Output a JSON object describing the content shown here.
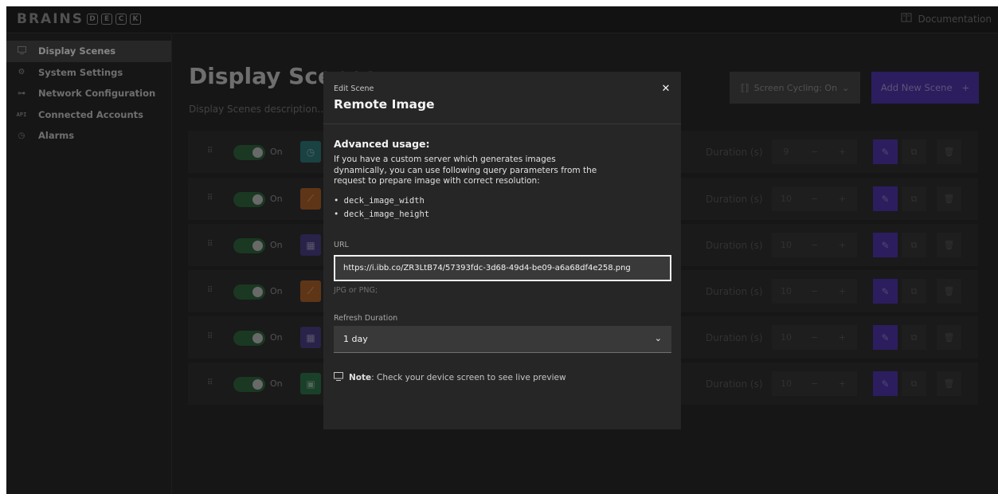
{
  "app": {
    "logo_text": "BRAINS",
    "logo_letters": [
      "D",
      "E",
      "C",
      "K"
    ],
    "docs_label": "Documentation",
    "docs_icon": "book-icon"
  },
  "sidebar": {
    "items": [
      {
        "label": "Display Scenes",
        "icon": "monitor-icon",
        "active": true
      },
      {
        "label": "System Settings",
        "icon": "gear-icon",
        "active": false
      },
      {
        "label": "Network Configuration",
        "icon": "network-icon",
        "active": false
      },
      {
        "label": "Connected Accounts",
        "icon": "api-icon",
        "active": false
      },
      {
        "label": "Alarms",
        "icon": "alarm-icon",
        "active": false
      }
    ]
  },
  "main": {
    "title": "Display Scenes",
    "description": "Display Scenes description...",
    "cycling_label": "Screen Cycling: On",
    "add_label": "Add New Scene",
    "add_icon": "+",
    "scenes": [
      {
        "on_label": "On",
        "icon": "clock-icon",
        "icon_color": "#1f6f70",
        "duration_label": "Duration (s)",
        "duration": "9"
      },
      {
        "on_label": "On",
        "icon": "chart-icon",
        "icon_color": "#a8541a",
        "duration_label": "Duration (s)",
        "duration": "10"
      },
      {
        "on_label": "On",
        "icon": "grid-icon",
        "icon_color": "#3c2f7c",
        "duration_label": "Duration (s)",
        "duration": "10"
      },
      {
        "on_label": "On",
        "icon": "chart-icon",
        "icon_color": "#a8541a",
        "duration_label": "Duration (s)",
        "duration": "10"
      },
      {
        "on_label": "On",
        "icon": "grid-icon",
        "icon_color": "#3c2f7c",
        "duration_label": "Duration (s)",
        "duration": "10"
      },
      {
        "on_label": "On",
        "icon": "image-icon",
        "icon_color": "#1e6b3c",
        "duration_label": "Duration (s)",
        "duration": "10"
      }
    ]
  },
  "modal": {
    "label": "Edit Scene",
    "title": "Remote Image",
    "close_icon": "close-icon",
    "adv_title": "Advanced usage:",
    "adv_desc": "If you have a custom server which generates images dynamically, you can use following query parameters from the request to prepare image with correct resolution:",
    "params": [
      "deck_image_width",
      "deck_image_height"
    ],
    "url_label": "URL",
    "url_value": "https://i.ibb.co/ZR3LtB74/57393fdc-3d68-49d4-be09-a6a68df4e258.png",
    "url_help": "JPG or PNG;",
    "refresh_label": "Refresh Duration",
    "refresh_value": "1 day",
    "note_bold": "Note",
    "note_text": ": Check your device screen to see live preview"
  },
  "colors": {
    "accent": "#4224a8",
    "toggle_on": "#24a148",
    "background": "#161616"
  }
}
